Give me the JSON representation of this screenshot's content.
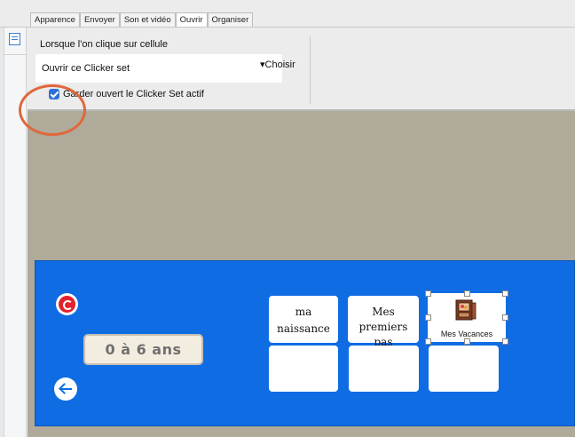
{
  "tabs": [
    {
      "label": "Apparence",
      "active": false
    },
    {
      "label": "Envoyer",
      "active": false
    },
    {
      "label": "Son et vidéo",
      "active": false
    },
    {
      "label": "Ouvrir",
      "active": true
    },
    {
      "label": "Organiser",
      "active": false
    }
  ],
  "panel": {
    "cell_click_label": "Lorsque l'on clique sur cellule",
    "action_value": "Ouvrir ce Clicker set",
    "choose_label": "▾Choisir",
    "keep_open_label": "Garder ouvert le Clicker Set actif",
    "keep_open_checked": true
  },
  "board": {
    "title": "0 à 6 ans",
    "cells": [
      {
        "line1": "ma",
        "line2": "naissance"
      },
      {
        "line1": "Mes",
        "line2": "premiers pas"
      },
      {
        "label": "Mes Vacances",
        "icon": "photo-album-icon",
        "selected": true
      },
      {
        "label": ""
      },
      {
        "label": ""
      },
      {
        "label": ""
      }
    ]
  },
  "colors": {
    "board": "#0f6ce3",
    "canvas": "#b0aa9a",
    "highlight_circle": "#e0673c",
    "undo": "#e2212e"
  }
}
